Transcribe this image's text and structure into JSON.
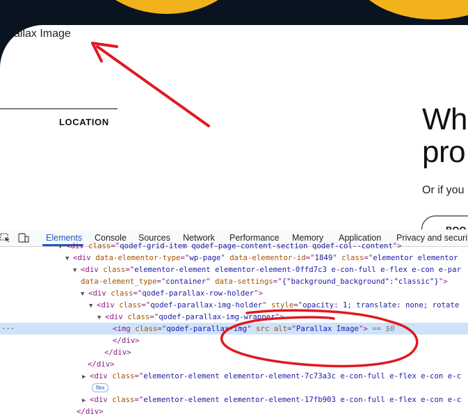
{
  "page": {
    "broken_image_alt": "allax Image",
    "location_label": "LOCATION",
    "headline_line1": "Wh",
    "headline_line2": "pro",
    "subtext": "Or if you",
    "cta_label": "BOO"
  },
  "devtools": {
    "tabs": [
      {
        "label": "Elements",
        "active": true
      },
      {
        "label": "Console"
      },
      {
        "label": "Sources"
      },
      {
        "label": "Network"
      },
      {
        "label": "Performance"
      },
      {
        "label": "Memory"
      },
      {
        "label": "Application"
      },
      {
        "label": "Privacy and security"
      }
    ],
    "dom": {
      "l0": {
        "tag": "div",
        "attr": "class",
        "val": "qodef-grid-item qodef-page-content-section qodef-col--content",
        "close": ">"
      },
      "l1": {
        "tag": "div",
        "a1": "data-elementor-type",
        "v1": "wp-page",
        "a2": "data-elementor-id",
        "v2": "1849",
        "a3": "class",
        "v3": "elementor elementor"
      },
      "l2": {
        "tag": "div",
        "attr": "class",
        "val": "elementor-element elementor-element-0ffd7c3 e-con-full e-flex e-con e-par"
      },
      "l3": {
        "a1": "data-element_type",
        "v1": "container",
        "a2": "data-settings",
        "v2": "{\"background_background\":\"classic\"}",
        "close": ">"
      },
      "l4": {
        "tag": "div",
        "attr": "class",
        "val": "qodef-parallax-row-holder",
        "close": ">"
      },
      "l5": {
        "tag": "div",
        "attr": "class",
        "val": "qodef-parallax-img-holder",
        "a2": "style",
        "v2": "opacity: 1; translate: none; rotate"
      },
      "l6": {
        "tag": "div",
        "attr": "class",
        "val": "qodef-parallax-img-wrapper",
        "close": ">"
      },
      "l7": {
        "tag": "img",
        "attr": "class",
        "val": "qodef-parallax-img",
        "a2": "src",
        "a3": "alt",
        "v3": "Parallax Image",
        "close": ">",
        "console_ref": "== $0"
      },
      "l8": {
        "close_tag": "</div>"
      },
      "l9": {
        "close_tag": "</div>"
      },
      "l10": {
        "close_tag": "</div>"
      },
      "l11": {
        "tag": "div",
        "attr": "class",
        "val": "elementor-element elementor-element-7c73a3c e-con-full e-flex e-con e-c"
      },
      "l12": {
        "badge": "flex"
      },
      "l13": {
        "tag": "div",
        "attr": "class",
        "val": "elementor-element elementor-element-17fb903 e-con-full e-flex e-con e-c"
      },
      "l14": {
        "close_tag": "</div>"
      }
    }
  },
  "colors": {
    "accent_yellow": "#f2b21c",
    "dark_navy": "#0a1420",
    "devtools_blue": "#1a56c8",
    "annotation_red": "#e0191f"
  }
}
